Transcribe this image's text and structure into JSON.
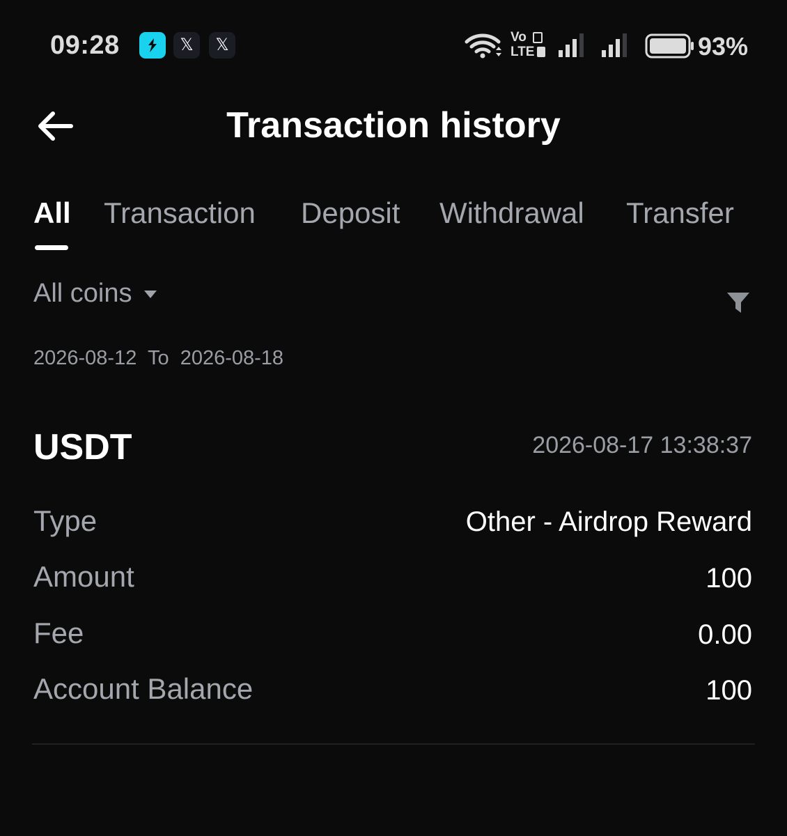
{
  "status_bar": {
    "time": "09:28",
    "battery_percent": "93%",
    "network_label_top": "Vo",
    "network_label_bottom": "LTE",
    "icons": [
      "app-icon",
      "x-icon",
      "x-icon",
      "wifi-icon",
      "volte-icon",
      "signal-icon",
      "signal-icon",
      "battery-icon"
    ]
  },
  "header": {
    "title": "Transaction history",
    "back_icon": "arrow-left-icon"
  },
  "tabs": [
    {
      "label": "All",
      "active": true
    },
    {
      "label": "Transaction",
      "active": false
    },
    {
      "label": "Deposit",
      "active": false
    },
    {
      "label": "Withdrawal",
      "active": false
    },
    {
      "label": "Transfer",
      "active": false
    }
  ],
  "filters": {
    "coin_selector": "All coins",
    "date_from": "2026-08-12",
    "date_separator": "To",
    "date_to": "2026-08-18",
    "filter_icon": "funnel-icon"
  },
  "transaction": {
    "coin": "USDT",
    "timestamp": "2026-08-17 13:38:37",
    "rows": [
      {
        "label": "Type",
        "value": "Other - Airdrop Reward"
      },
      {
        "label": "Amount",
        "value": "100"
      },
      {
        "label": "Fee",
        "value": "0.00"
      },
      {
        "label": "Account Balance",
        "value": "100"
      }
    ]
  },
  "colors": {
    "background": "#0b0b0c",
    "primary_text": "#ffffff",
    "secondary_text": "#a4a7ad",
    "app_icon_accent": "#19d3ee"
  }
}
